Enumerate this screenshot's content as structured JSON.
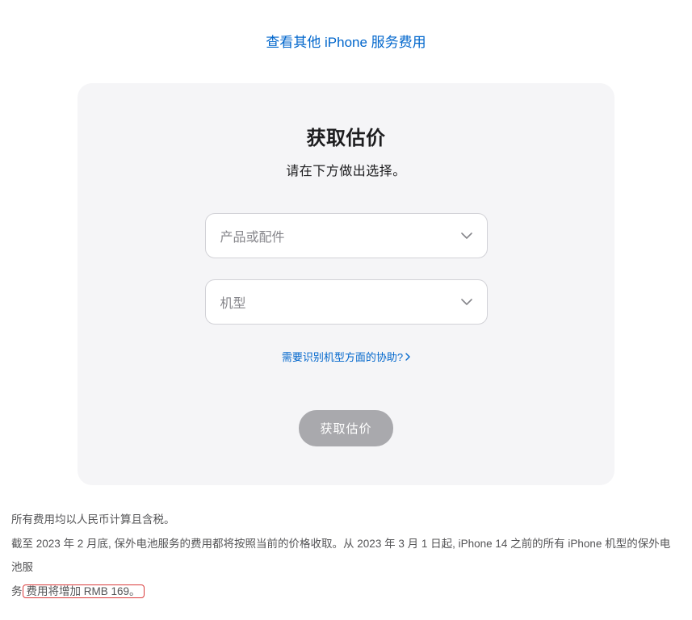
{
  "top_link": {
    "label": "查看其他 iPhone 服务费用"
  },
  "card": {
    "title": "获取估价",
    "subtitle": "请在下方做出选择。",
    "select_product_placeholder": "产品或配件",
    "select_model_placeholder": "机型",
    "help_link_label": "需要识别机型方面的协助?",
    "submit_label": "获取估价"
  },
  "footer": {
    "line1": "所有费用均以人民币计算且含税。",
    "line2_part1": "截至 2023 年 2 月底, 保外电池服务的费用都将按照当前的价格收取。从 2023 年 3 月 1 日起, iPhone 14 之前的所有 iPhone 机型的保外电池服",
    "line2_part2_prefix": "务",
    "line2_highlight": "费用将增加 RMB 169。"
  }
}
